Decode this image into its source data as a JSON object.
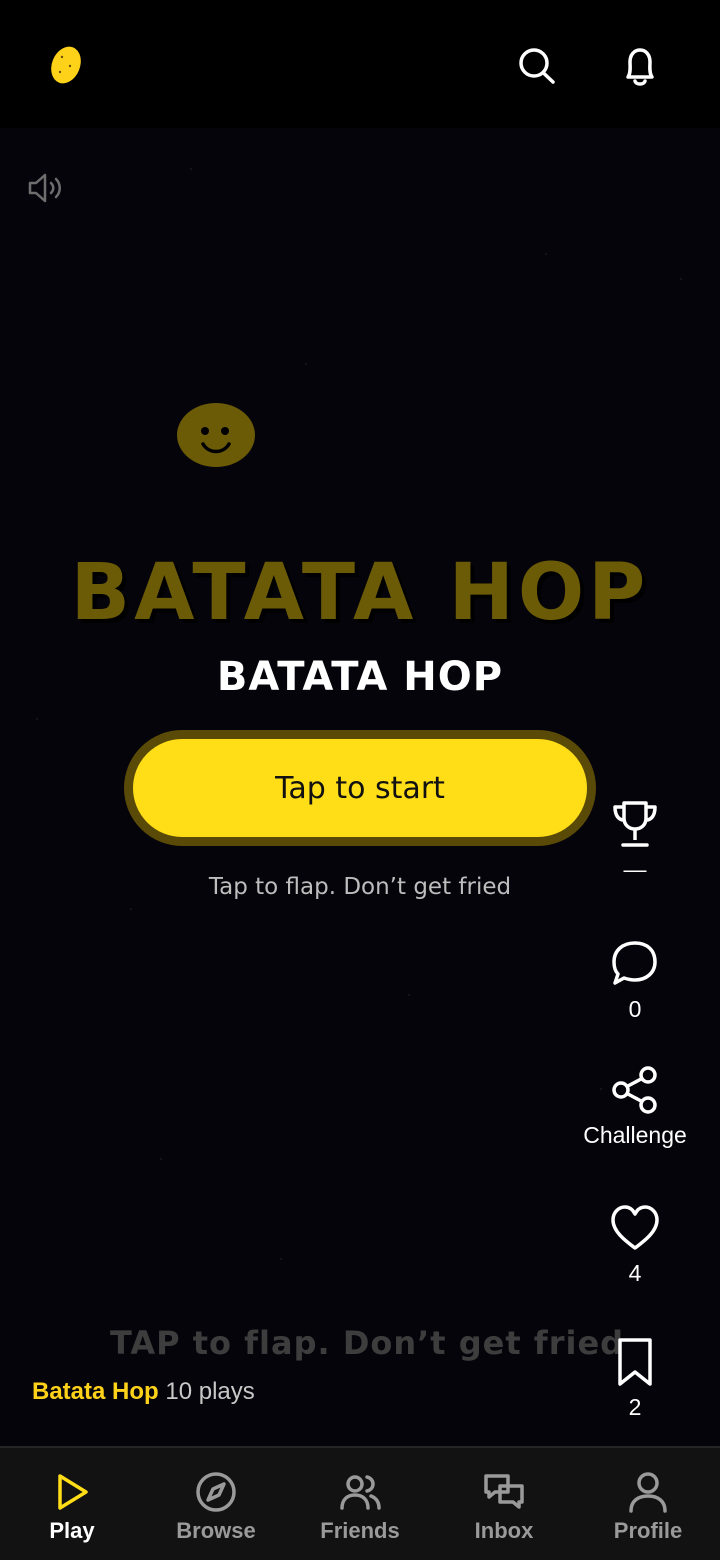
{
  "header": {
    "logo_icon": "potato-logo-icon",
    "search_icon": "search-icon",
    "notifications_icon": "bell-icon"
  },
  "game": {
    "sound_icon": "speaker-icon",
    "title_big": "BATATA HOP",
    "title": "BATATA HOP",
    "start_label": "Tap to start",
    "hint": "Tap to flap. Don’t get fried",
    "overlay_hint": "TAP to flap. Don’t get fried",
    "name": "Batata Hop",
    "plays": "10 plays",
    "accent_color": "#ffdd17"
  },
  "rail": {
    "leaderboard": {
      "icon": "trophy-icon",
      "label": "—"
    },
    "comments": {
      "icon": "comment-icon",
      "label": "0"
    },
    "share": {
      "icon": "share-icon",
      "label": "Challenge"
    },
    "like": {
      "icon": "heart-icon",
      "label": "4"
    },
    "save": {
      "icon": "bookmark-icon",
      "label": "2"
    }
  },
  "nav": {
    "play": "Play",
    "browse": "Browse",
    "friends": "Friends",
    "inbox": "Inbox",
    "profile": "Profile"
  }
}
